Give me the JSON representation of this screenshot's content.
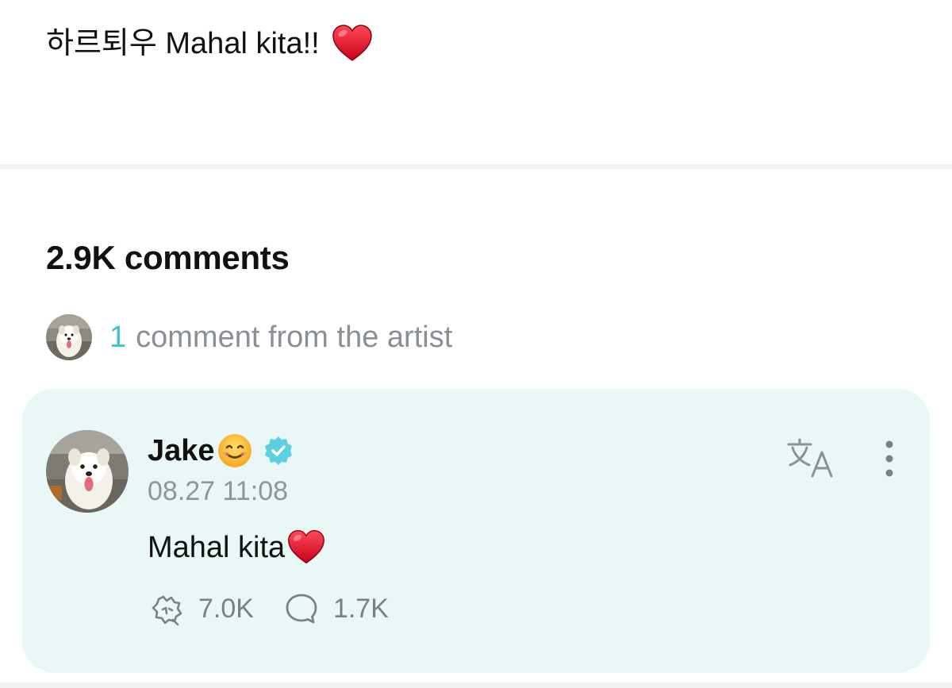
{
  "post": {
    "text": "하르퇴우 Mahal kita!!",
    "emoji_icon": "red-heart-icon"
  },
  "comments_section": {
    "count_label": "2.9K comments"
  },
  "artist_summary": {
    "count": "1",
    "label": "comment from the artist",
    "avatar_icon": "dog-avatar"
  },
  "comment": {
    "author": "Jake",
    "author_emoji_icon": "smiling-face-icon",
    "verified_icon": "verified-badge-icon",
    "timestamp": "08.27 11:08",
    "text": "Mahal kita",
    "text_emoji_icon": "red-heart-icon",
    "likes": "7.0K",
    "replies": "1.7K",
    "like_icon": "like-paw-icon",
    "reply_icon": "speech-bubble-icon",
    "translate_icon": "translate-icon",
    "more_icon": "more-vertical-icon"
  },
  "colors": {
    "accent": "#3ec5cc",
    "card_bg": "#e9f8f6",
    "muted_text": "#8a8f95",
    "heart": "#e0102a"
  }
}
